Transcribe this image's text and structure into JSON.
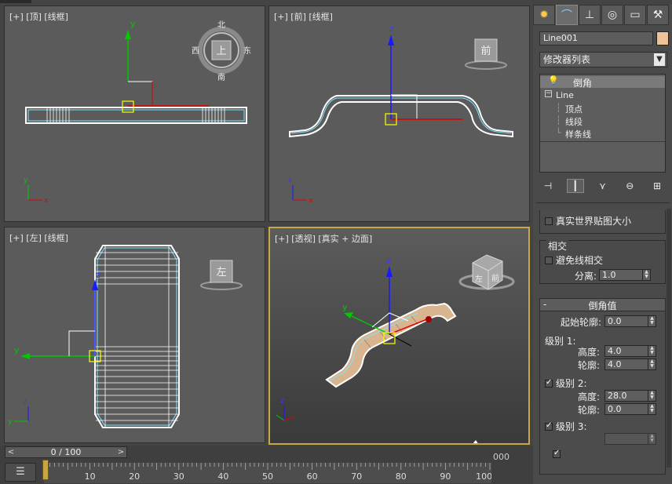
{
  "viewports": {
    "top": {
      "label": "[+] [顶] [线框]",
      "cube_label": "上",
      "compass": {
        "n": "北",
        "s": "南",
        "e": "东",
        "w": "西"
      }
    },
    "front": {
      "label": "[+] [前] [线框]",
      "cube_label": "前"
    },
    "left": {
      "label": "[+] [左] [线框]",
      "cube_label": "左"
    },
    "perspective": {
      "label": "[+] [透视] [真实 + 边面]",
      "cube_label_a": "左",
      "cube_label_b": "前"
    }
  },
  "axis_labels": {
    "x": "x",
    "y": "y",
    "z": "z"
  },
  "command_panel": {
    "tabs": [
      {
        "name": "create-tab",
        "icon": "sun-icon"
      },
      {
        "name": "modify-tab",
        "icon": "curve-icon"
      },
      {
        "name": "hierarchy-tab",
        "icon": "hierarchy-icon"
      },
      {
        "name": "motion-tab",
        "icon": "motion-icon"
      },
      {
        "name": "display-tab",
        "icon": "display-icon"
      },
      {
        "name": "utilities-tab",
        "icon": "hammer-icon"
      }
    ],
    "object_name": "Line001",
    "object_color": "#f0c29a",
    "modifier_list": "修改器列表",
    "stack": {
      "bevel": "倒角",
      "line": "Line",
      "vertex": "顶点",
      "segment": "线段",
      "spline": "样条线"
    },
    "real_world_map_size": "真实世界贴图大小",
    "intersections": {
      "title": "相交",
      "avoid_label": "避免线相交",
      "separation_label": "分离:",
      "separation_value": "1.0"
    },
    "bevel_values": {
      "title": "倒角值",
      "start_outline_label": "起始轮廓:",
      "start_outline_value": "0.0",
      "level1_label": "级别 1:",
      "level1_height_label": "高度:",
      "level1_height_value": "4.0",
      "level1_outline_label": "轮廓:",
      "level1_outline_value": "4.0",
      "level2_label": "级别 2:",
      "level2_height_label": "高度:",
      "level2_height_value": "28.0",
      "level2_outline_label": "轮廓:",
      "level2_outline_value": "0.0",
      "level3_label": "级别 3:"
    }
  },
  "timeline": {
    "slider_value": "0 / 100",
    "ticks": [
      "10",
      "20",
      "30",
      "40",
      "50",
      "60",
      "70",
      "80",
      "90",
      "100"
    ],
    "partial_right": "000"
  },
  "colors": {
    "accent": "#c9a64a",
    "viewport_bg": "#5b5b5b",
    "panel_bg": "#4a4a4a",
    "selection_white": "#ffffff",
    "highlight_cyan": "#7fe3ff"
  }
}
